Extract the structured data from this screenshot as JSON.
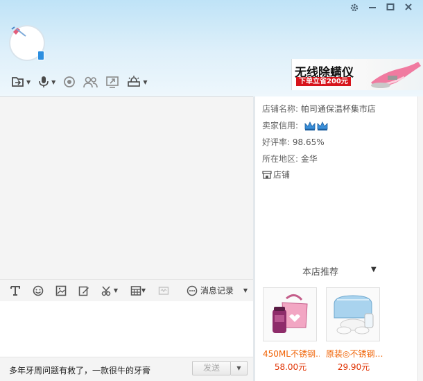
{
  "window": {
    "settings_icon": "gear-icon",
    "minimize_icon": "minimize-icon",
    "maximize_icon": "maximize-icon",
    "close_icon": "close-icon"
  },
  "toolbar": {
    "items": [
      {
        "icon": "file-transfer-icon",
        "has_dropdown": true
      },
      {
        "icon": "microphone-icon",
        "has_dropdown": true
      },
      {
        "icon": "webcam-icon",
        "has_dropdown": false
      },
      {
        "icon": "group-users-icon",
        "has_dropdown": false
      },
      {
        "icon": "screen-share-icon",
        "has_dropdown": false
      },
      {
        "icon": "remote-assist-icon",
        "has_dropdown": true
      }
    ]
  },
  "ad_banner": {
    "title": "无线除螨仪",
    "subtitle": "下单立省200元"
  },
  "input_toolbar": {
    "history_label": "消息记录"
  },
  "bottom": {
    "ad_text": "多年牙周问题有救了，一款很牛的牙膏",
    "send_label": "发送"
  },
  "shop": {
    "name_label": "店铺名称:",
    "name_value": "帕司通保温杯集市店",
    "credit_label": "卖家信用:",
    "rating_label": "好评率:",
    "rating_value": "98.65%",
    "region_label": "所在地区:",
    "region_value": "金华",
    "shop_link_label": "店铺"
  },
  "recommend": {
    "title": "本店推荐",
    "products": [
      {
        "title": "450ML不锈钢…",
        "price": "58.00元"
      },
      {
        "title": "原装◎不锈钢…",
        "price": "29.90元"
      }
    ]
  },
  "colors": {
    "header_top": "#bfe3f7",
    "price_red": "#e03000",
    "ad_red": "#d7141b"
  }
}
